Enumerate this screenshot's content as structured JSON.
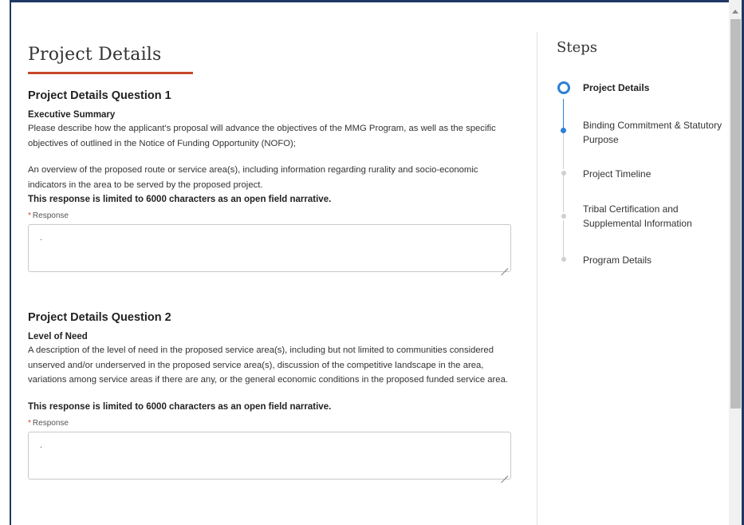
{
  "page": {
    "title": "Project Details"
  },
  "questions": [
    {
      "heading": "Project Details Question 1",
      "subheading": "Executive Summary",
      "paragraph1": "Please describe how the applicant's proposal will advance the objectives of the MMG Program, as well as the specific objectives of outlined in the Notice of Funding Opportunity (NOFO);",
      "paragraph2": "An overview of the proposed route or service area(s), including information regarding rurality and socio-economic indicators in the area to be served by the proposed project.",
      "limit_note": "This response is limited to 6000 characters as an open field narrative.",
      "response_label": "Response",
      "response_value": "."
    },
    {
      "heading": "Project Details Question 2",
      "subheading": "Level of Need",
      "paragraph1": "A description of the level of need in the proposed service area(s), including but not limited to communities considered unserved and/or underserved in the proposed service area(s), discussion of the competitive landscape in the area, variations among service areas if there are any, or the general economic conditions in the proposed funded service area.",
      "limit_note": "This response is limited to 6000 characters as an open field narrative.",
      "response_label": "Response",
      "response_value": "."
    }
  ],
  "steps": {
    "title": "Steps",
    "items": [
      {
        "label": "Project Details",
        "state": "current"
      },
      {
        "label": "Binding Commitment & Statutory Purpose",
        "state": "done"
      },
      {
        "label": "Project Timeline",
        "state": "todo"
      },
      {
        "label": "Tribal Certification and Supplemental Information",
        "state": "todo"
      },
      {
        "label": "Program Details",
        "state": "todo"
      }
    ]
  },
  "colors": {
    "accent_underline": "#c8472b",
    "step_active": "#2e7fd6",
    "step_inactive": "#cfcfcf",
    "frame_border": "#1f3864"
  },
  "required_marker": "*"
}
